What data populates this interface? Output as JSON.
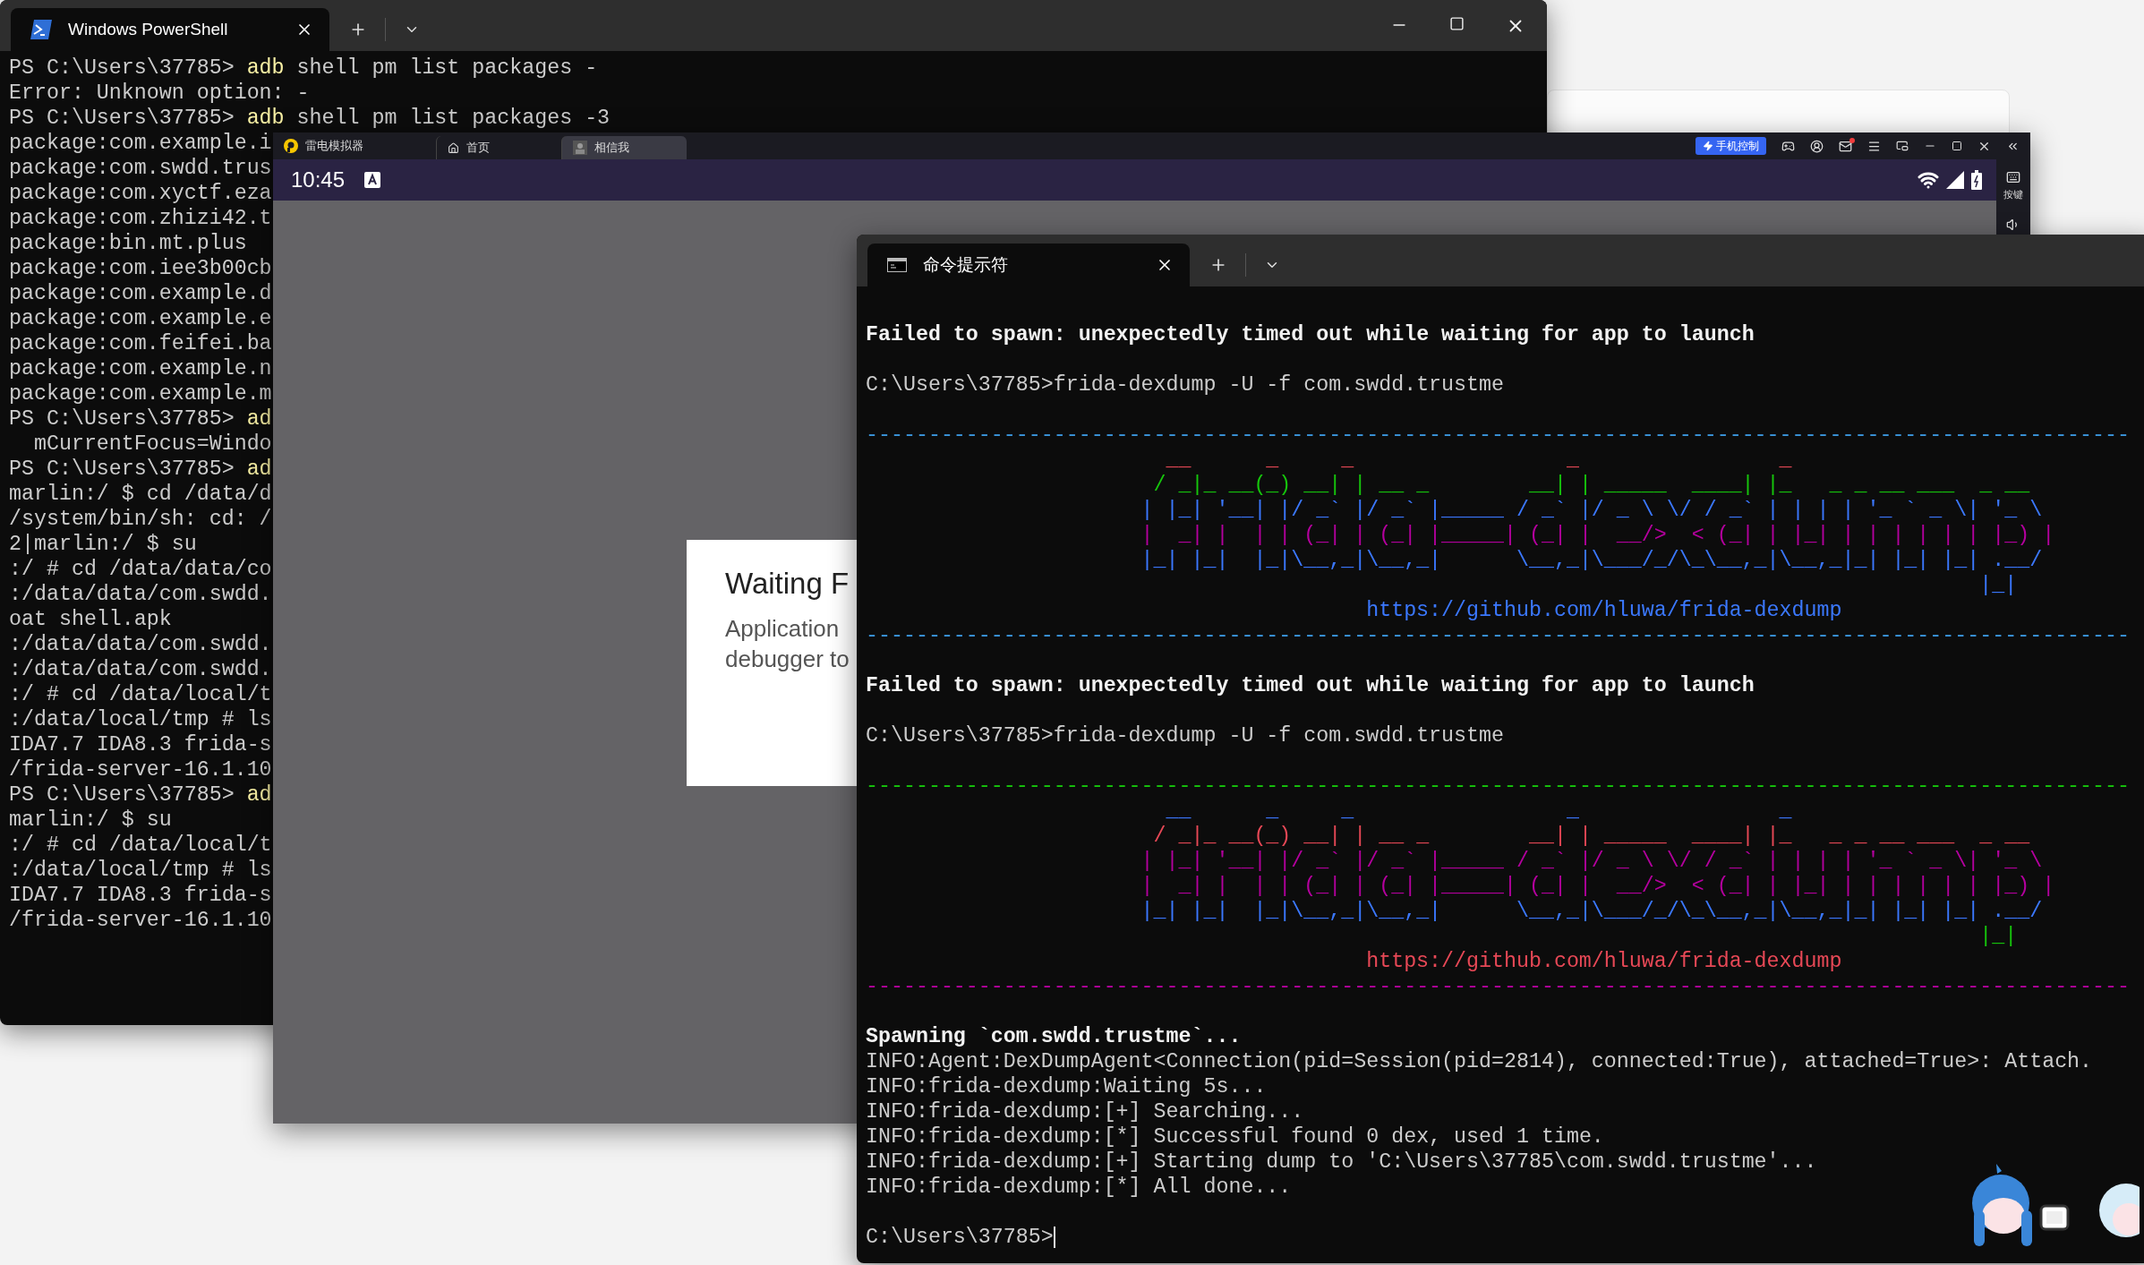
{
  "powershell": {
    "tab": {
      "title": "Windows PowerShell",
      "selected": true
    },
    "lines": [
      {
        "kind": "command",
        "prompt": "PS C:\\Users\\37785>",
        "program": "adb",
        "args": "shell pm list packages -"
      },
      {
        "kind": "output",
        "text": "Error: Unknown option: -"
      },
      {
        "kind": "command",
        "prompt": "PS C:\\Users\\37785>",
        "program": "adb",
        "args": "shell pm list packages -3"
      },
      {
        "kind": "output",
        "text": "package:com.example.i"
      },
      {
        "kind": "output",
        "text": "package:com.swdd.trus"
      },
      {
        "kind": "output",
        "text": "package:com.xyctf.eza"
      },
      {
        "kind": "output",
        "text": "package:com.zhizi42.t"
      },
      {
        "kind": "output",
        "text": "package:bin.mt.plus"
      },
      {
        "kind": "output",
        "text": "package:com.iee3b00cb"
      },
      {
        "kind": "output",
        "text": "package:com.example.d"
      },
      {
        "kind": "output",
        "text": "package:com.example.e"
      },
      {
        "kind": "output",
        "text": "package:com.feifei.ba"
      },
      {
        "kind": "output",
        "text": "package:com.example.n"
      },
      {
        "kind": "output",
        "text": "package:com.example.m"
      },
      {
        "kind": "command",
        "prompt": "PS C:\\Users\\37785>",
        "program": "ad"
      },
      {
        "kind": "output",
        "text": "  mCurrentFocus=Windo"
      },
      {
        "kind": "command",
        "prompt": "PS C:\\Users\\37785>",
        "program": "ad"
      },
      {
        "kind": "output",
        "text": "marlin:/ $ cd /data/d"
      },
      {
        "kind": "output",
        "text": "/system/bin/sh: cd: /"
      },
      {
        "kind": "output",
        "text": "2|marlin:/ $ su"
      },
      {
        "kind": "output",
        "text": ":/ # cd /data/data/co"
      },
      {
        "kind": "output",
        "text": ":/data/data/com.swdd."
      },
      {
        "kind": "output",
        "text": "oat shell.apk"
      },
      {
        "kind": "output",
        "text": ":/data/data/com.swdd."
      },
      {
        "kind": "output",
        "text": ":/data/data/com.swdd."
      },
      {
        "kind": "output",
        "text": ":/ # cd /data/local/t"
      },
      {
        "kind": "output",
        "text": ":/data/local/tmp # ls"
      },
      {
        "kind": "output",
        "text": "IDA7.7 IDA8.3 frida-s"
      },
      {
        "kind": "output",
        "text": "/frida-server-16.1.10"
      },
      {
        "kind": "command",
        "prompt": "PS C:\\Users\\37785>",
        "program": "ad"
      },
      {
        "kind": "output",
        "text": "marlin:/ $ su"
      },
      {
        "kind": "output",
        "text": ":/ # cd /data/local/t"
      },
      {
        "kind": "output",
        "text": ":/data/local/tmp # ls"
      },
      {
        "kind": "output",
        "text": "IDA7.7 IDA8.3 frida-s"
      },
      {
        "kind": "output",
        "text": "/frida-server-16.1.10"
      }
    ]
  },
  "emulator": {
    "app_name": "雷电模拟器",
    "tabs": [
      {
        "label": "首页",
        "selected": false
      },
      {
        "label": "相信我",
        "selected": true
      }
    ],
    "control_button": "手机控制",
    "time": "10:45",
    "side_label": "按键",
    "dialog": {
      "title": "Waiting F",
      "body": "Application debugger to"
    }
  },
  "cmd": {
    "tab": {
      "title": "命令提示符",
      "selected": true
    },
    "lines": [
      {
        "kind": "bold",
        "text": "Failed to spawn: unexpectedly timed out while waiting for app to launch"
      },
      {
        "kind": "blank"
      },
      {
        "kind": "plain",
        "text": "C:\\Users\\37785>frida-dexdump -U -f com.swdd.trustme"
      },
      {
        "kind": "blank"
      },
      {
        "kind": "rule",
        "color": "#3a96dd",
        "text": "-----------------------------------------------------------------------------------------------------"
      },
      {
        "kind": "art",
        "color": "#e74856",
        "text": "  __      _     _                 _                _"
      },
      {
        "kind": "art",
        "color": "#16c60c",
        "text": " / _|_ __(_) __| | __ _        __| | _____  ____| |_   _ _ __ ___  _ __"
      },
      {
        "kind": "art",
        "color": "#3b78ff",
        "text": "| |_| '__| |/ _` |/ _` |_____ / _` |/ _ \\ \\/ / _` | | | | '_ ` _ \\| '_ \\"
      },
      {
        "kind": "art",
        "color": "#b4009e",
        "text": "|  _| |  | | (_| | (_| |_____| (_| |  __/>  < (_| | |_| | | | | | | |_) |"
      },
      {
        "kind": "art",
        "color": "#3b78ff",
        "text": "|_| |_|  |_|\\__,_|\\__,_|      \\__,_|\\___/_/\\_\\__,_|\\__,_|_| |_| |_| .__/"
      },
      {
        "kind": "art",
        "color": "#3b78ff",
        "text": "                                                                   |_|"
      },
      {
        "kind": "link",
        "color": "#3b78ff",
        "text": "https://github.com/hluwa/frida-dexdump"
      },
      {
        "kind": "rule",
        "color": "#3a96dd",
        "text": "-----------------------------------------------------------------------------------------------------"
      },
      {
        "kind": "blank"
      },
      {
        "kind": "bold",
        "text": "Failed to spawn: unexpectedly timed out while waiting for app to launch"
      },
      {
        "kind": "blank"
      },
      {
        "kind": "plain",
        "text": "C:\\Users\\37785>frida-dexdump -U -f com.swdd.trustme"
      },
      {
        "kind": "blank"
      },
      {
        "kind": "rule",
        "color": "#16c60c",
        "text": "-----------------------------------------------------------------------------------------------------"
      },
      {
        "kind": "art",
        "color": "#3b78ff",
        "text": "  __      _     _                 _                _"
      },
      {
        "kind": "art",
        "color": "#e74856",
        "text": " / _|_ __(_) __| | __ _        __| | _____  ____| |_   _ _ __ ___  _ __"
      },
      {
        "kind": "art",
        "color": "#b4009e",
        "text": "| |_| '__| |/ _` |/ _` |_____ / _` |/ _ \\ \\/ / _` | | | | '_ ` _ \\| '_ \\"
      },
      {
        "kind": "art",
        "color": "#b4009e",
        "text": "|  _| |  | | (_| | (_| |_____| (_| |  __/>  < (_| | |_| | | | | | | |_) |"
      },
      {
        "kind": "art",
        "color": "#3b78ff",
        "text": "|_| |_|  |_|\\__,_|\\__,_|      \\__,_|\\___/_/\\_\\__,_|\\__,_|_| |_| |_| .__/"
      },
      {
        "kind": "art",
        "color": "#16c60c",
        "text": "                                                                   |_|"
      },
      {
        "kind": "link",
        "color": "#e74856",
        "text": "https://github.com/hluwa/frida-dexdump"
      },
      {
        "kind": "rule",
        "color": "#b4009e",
        "text": "-----------------------------------------------------------------------------------------------------"
      },
      {
        "kind": "blank"
      },
      {
        "kind": "bold",
        "text": "Spawning `com.swdd.trustme`..."
      },
      {
        "kind": "plain",
        "text": "INFO:Agent:DexDumpAgent<Connection(pid=Session(pid=2814), connected:True), attached=True>: Attach."
      },
      {
        "kind": "plain",
        "text": "INFO:frida-dexdump:Waiting 5s..."
      },
      {
        "kind": "plain",
        "text": "INFO:frida-dexdump:[+] Searching..."
      },
      {
        "kind": "plain",
        "text": "INFO:frida-dexdump:[*] Successful found 0 dex, used 1 time."
      },
      {
        "kind": "plain",
        "text": "INFO:frida-dexdump:[+] Starting dump to 'C:\\Users\\37785\\com.swdd.trustme'..."
      },
      {
        "kind": "plain",
        "text": "INFO:frida-dexdump:[*] All done..."
      },
      {
        "kind": "blank"
      },
      {
        "kind": "prompt",
        "text": "C:\\Users\\37785>"
      }
    ]
  }
}
